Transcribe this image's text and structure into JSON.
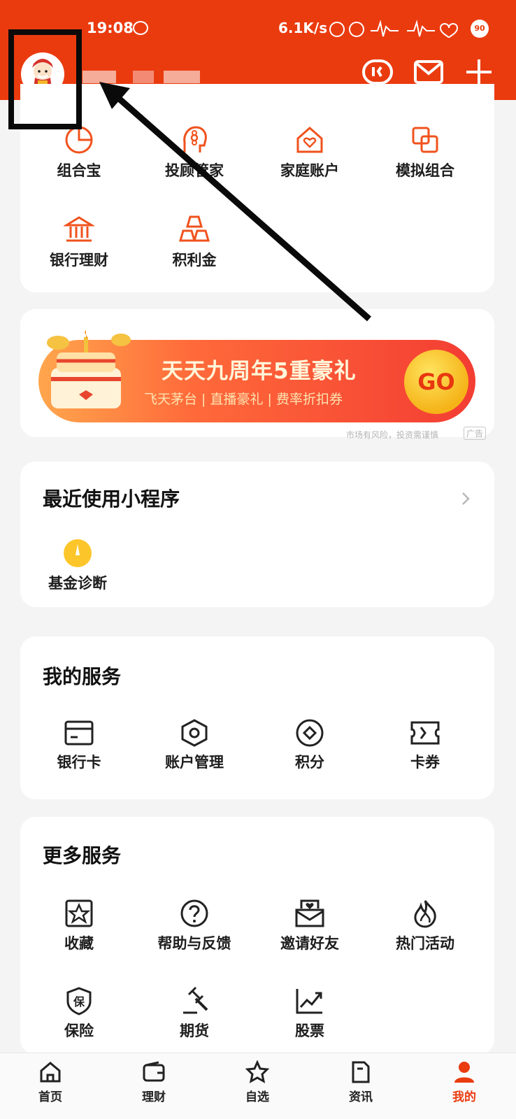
{
  "status_bar": {
    "time": "19:08",
    "network_speed": "6.1K/s",
    "battery": "90"
  },
  "header": {
    "icons": [
      "robot-icon",
      "mail-icon",
      "plus-icon"
    ]
  },
  "features": {
    "row1": [
      "组合宝",
      "投顾管家",
      "家庭账户",
      "模拟组合"
    ],
    "row2": [
      "银行理财",
      "积利金"
    ]
  },
  "banner": {
    "title": "天天九周年5重豪礼",
    "subtitle": "飞天茅台 | 直播豪礼 | 费率折扣券",
    "cta": "GO",
    "disclaimer": "市场有风险，投资需谨慎",
    "ad_tag": "广告"
  },
  "recent": {
    "title": "最近使用小程序",
    "items": [
      "基金诊断"
    ]
  },
  "my_services": {
    "title": "我的服务",
    "items": [
      "银行卡",
      "账户管理",
      "积分",
      "卡券"
    ]
  },
  "more_services": {
    "title": "更多服务",
    "row1": [
      "收藏",
      "帮助与反馈",
      "邀请好友",
      "热门活动"
    ],
    "row2": [
      "保险",
      "期货",
      "股票"
    ]
  },
  "tabbar": {
    "tabs": [
      "首页",
      "理财",
      "自选",
      "资讯",
      "我的"
    ],
    "active": "我的"
  },
  "colors": {
    "brand": "#ea3b0f",
    "icon": "#f0521d",
    "background": "#f4f4f5"
  }
}
